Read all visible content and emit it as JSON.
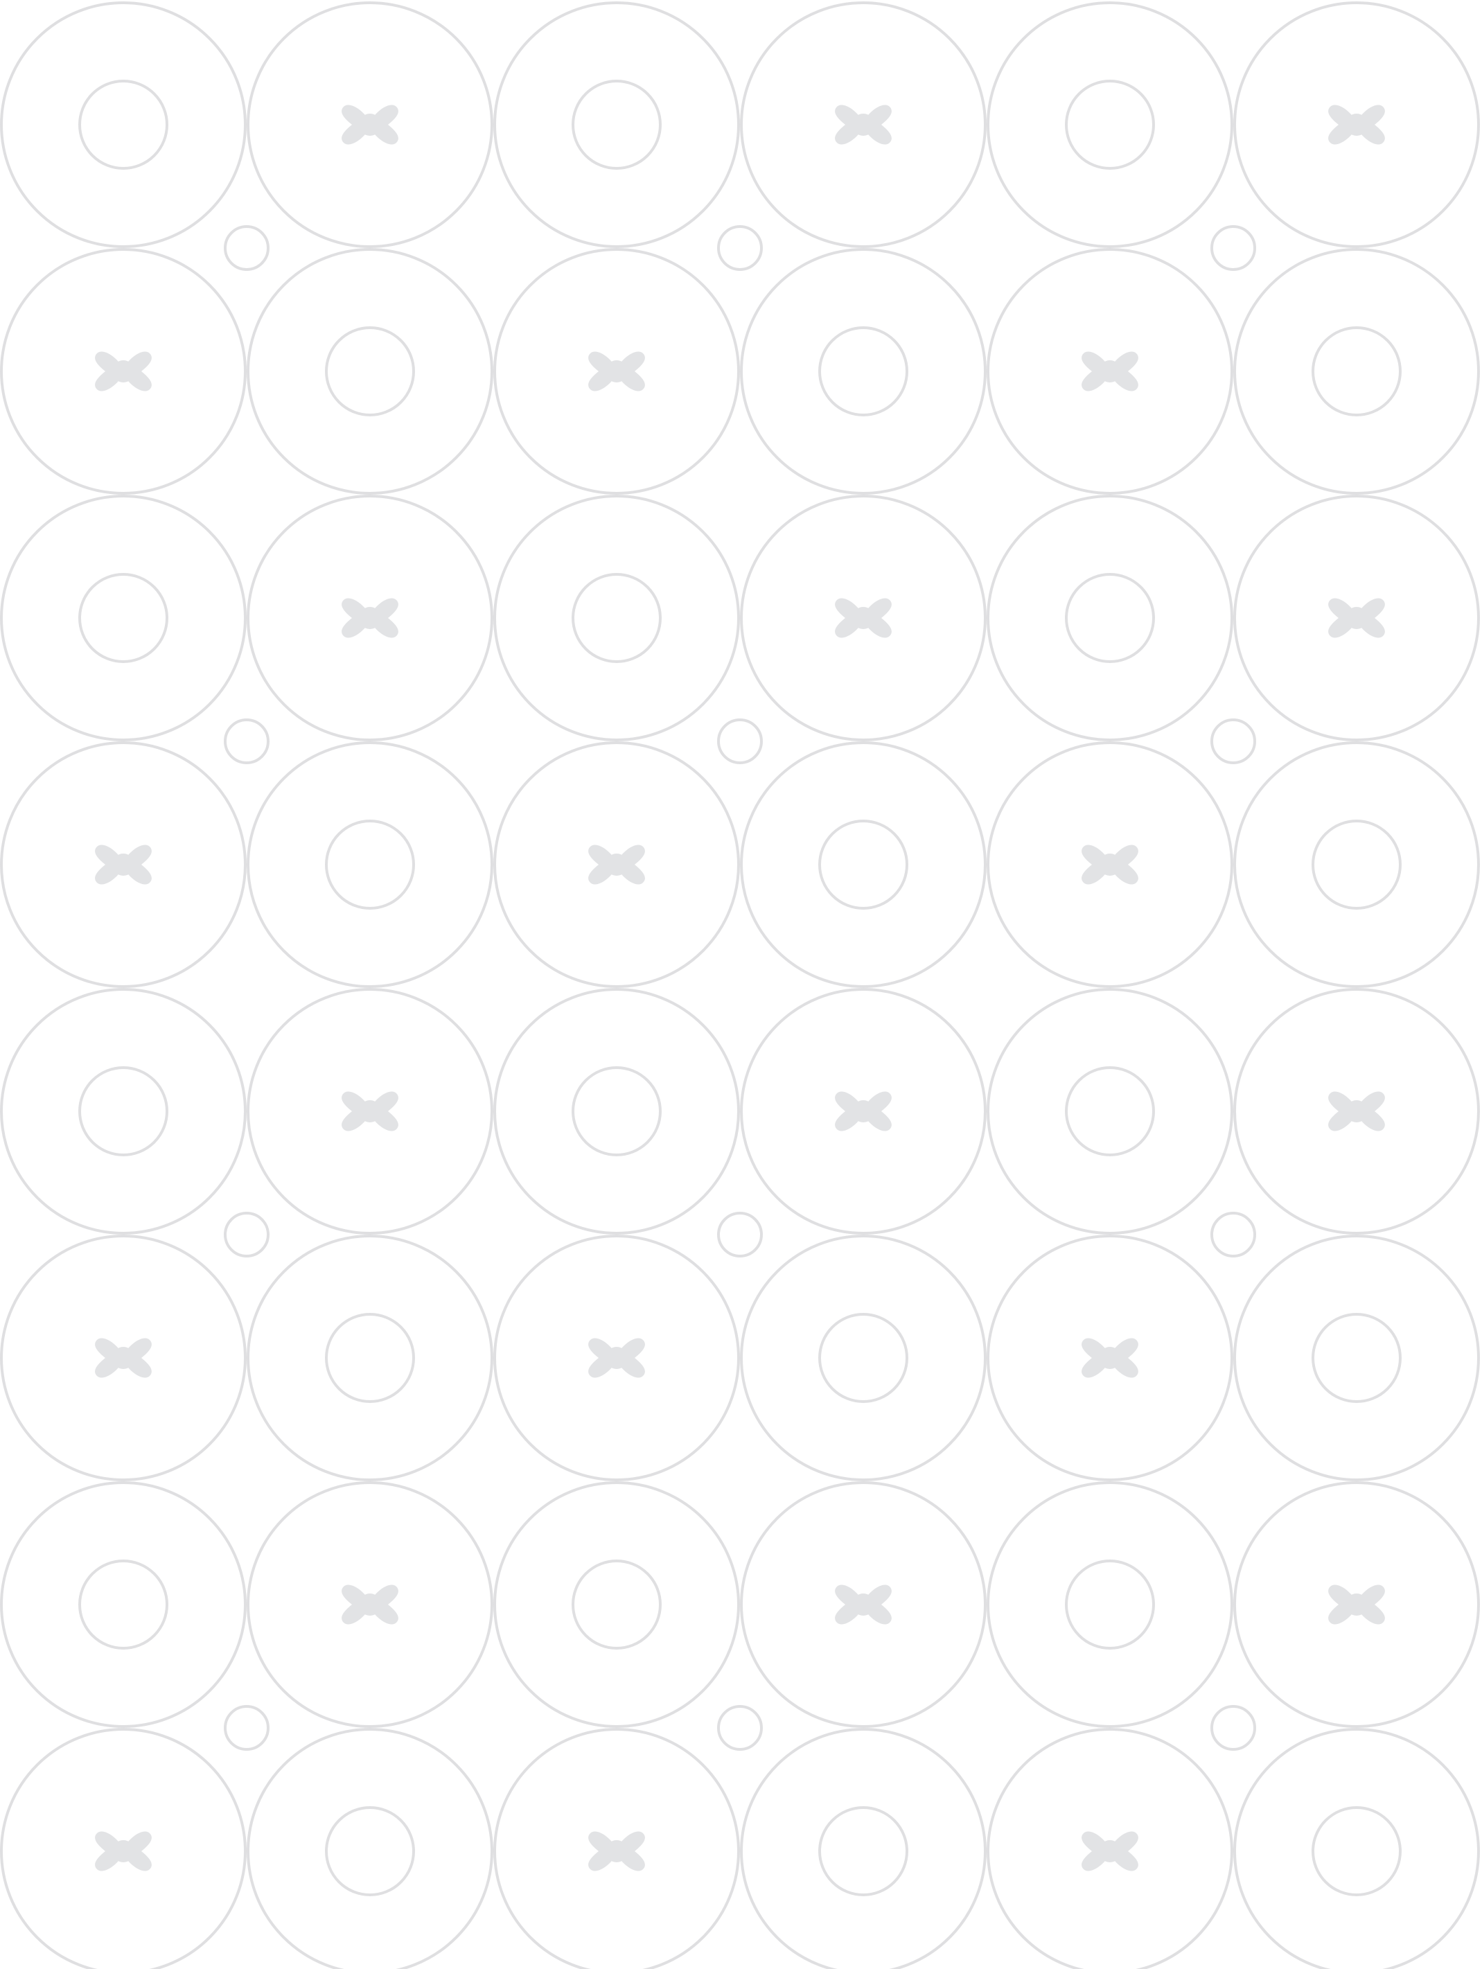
{
  "pattern": {
    "background_color": "#ffffff",
    "stroke_color": "#dfdfe1",
    "fill_color": "#e2e3e5",
    "rows": 8,
    "columns": 6,
    "cells": [
      [
        "ring-icon",
        "cross-icon",
        "ring-icon",
        "cross-icon",
        "ring-icon",
        "cross-icon"
      ],
      [
        "cross-icon",
        "ring-icon",
        "cross-icon",
        "ring-icon",
        "cross-icon",
        "ring-icon"
      ],
      [
        "ring-icon",
        "cross-icon",
        "ring-icon",
        "cross-icon",
        "ring-icon",
        "cross-icon"
      ],
      [
        "cross-icon",
        "ring-icon",
        "cross-icon",
        "ring-icon",
        "cross-icon",
        "ring-icon"
      ],
      [
        "ring-icon",
        "cross-icon",
        "ring-icon",
        "cross-icon",
        "ring-icon",
        "cross-icon"
      ],
      [
        "cross-icon",
        "ring-icon",
        "cross-icon",
        "ring-icon",
        "cross-icon",
        "ring-icon"
      ],
      [
        "ring-icon",
        "cross-icon",
        "ring-icon",
        "cross-icon",
        "ring-icon",
        "cross-icon"
      ],
      [
        "cross-icon",
        "ring-icon",
        "cross-icon",
        "ring-icon",
        "cross-icon",
        "ring-icon"
      ]
    ]
  }
}
